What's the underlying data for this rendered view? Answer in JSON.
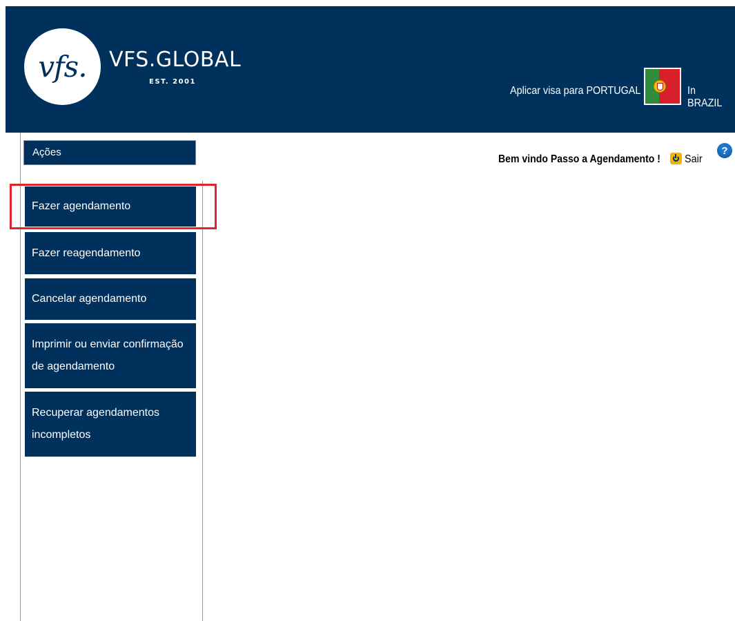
{
  "header": {
    "logo_mark": "vfs.",
    "logo_name": "VFS.GLOBAL",
    "logo_est": "EST. 2001",
    "apply_text": "Aplicar visa para PORTUGAL",
    "country_text": "In BRAZIL",
    "flag_icon": "portugal-flag-icon"
  },
  "topbar": {
    "welcome": "Bem vindo Passo a Agendamento !",
    "logout": "Sair",
    "help": "?"
  },
  "sidebar": {
    "title": "Ações",
    "items": [
      {
        "label": "Fazer agendamento"
      },
      {
        "label": "Fazer reagendamento"
      },
      {
        "label": "Cancelar agendamento"
      },
      {
        "label": "Imprimir ou enviar confirmação de agendamento"
      },
      {
        "label": "Recuperar agendamentos incompletos"
      }
    ]
  },
  "colors": {
    "brand": "#00305c",
    "highlight": "#e0242c",
    "logout_icon": "#f2b400",
    "help_icon": "#1e75c9"
  }
}
